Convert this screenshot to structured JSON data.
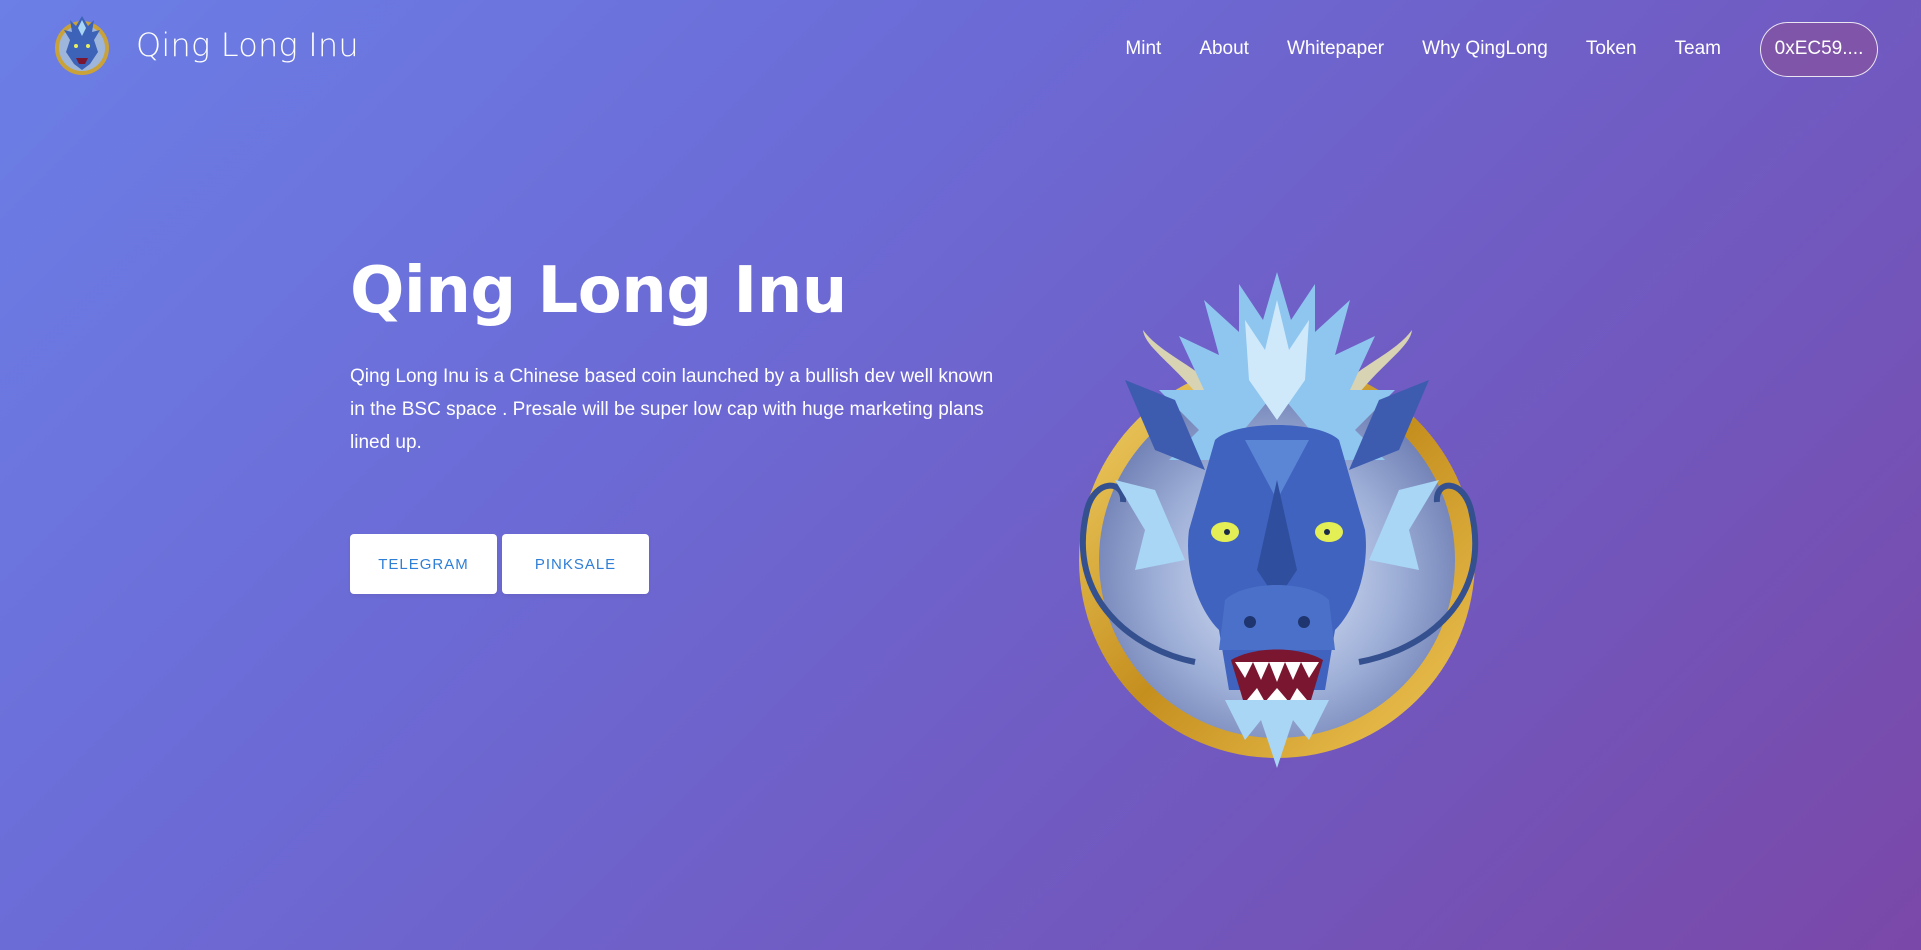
{
  "header": {
    "brand_name": "Qing Long Inu",
    "logo_icon": "dragon-logo-icon",
    "nav": [
      {
        "label": "Mint"
      },
      {
        "label": "About"
      },
      {
        "label": "Whitepaper"
      },
      {
        "label": "Why QingLong"
      },
      {
        "label": "Token"
      },
      {
        "label": "Team"
      }
    ],
    "wallet_label": "0xEC59...."
  },
  "hero": {
    "title": "Qing Long Inu",
    "description": "Qing Long Inu is a Chinese based coin launched by a bullish dev well known in the BSC space . Presale will be super low cap with huge marketing plans lined up.",
    "buttons": [
      {
        "label": "TELEGRAM"
      },
      {
        "label": "PINKSALE"
      }
    ],
    "art_icon": "dragon-coin-illustration"
  },
  "colors": {
    "background_start": "#6b7fe6",
    "background_end": "#7a48a8",
    "button_text": "#2f7fd6",
    "button_bg": "#ffffff"
  }
}
